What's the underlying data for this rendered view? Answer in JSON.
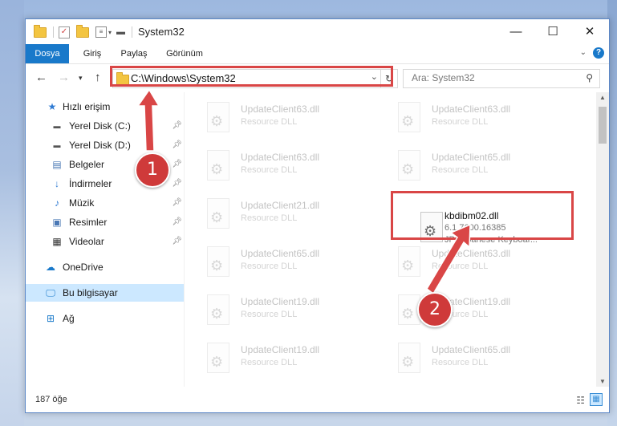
{
  "window": {
    "title": "System32",
    "controls": {
      "minimize": "—",
      "maximize": "☐",
      "close": "✕"
    }
  },
  "ribbon": {
    "tabs": [
      "Dosya",
      "Giriş",
      "Paylaş",
      "Görünüm"
    ],
    "help": "?"
  },
  "navigation": {
    "address": "C:\\Windows\\System32",
    "search_placeholder": "Ara: System32"
  },
  "sidebar": {
    "items": [
      {
        "label": "Hızlı erişim",
        "icon": "star-icon"
      },
      {
        "label": "Yerel Disk (C:)",
        "icon": "drive-icon"
      },
      {
        "label": "Yerel Disk (D:)",
        "icon": "drive-icon"
      },
      {
        "label": "Belgeler",
        "icon": "documents-icon"
      },
      {
        "label": "İndirmeler",
        "icon": "download-icon"
      },
      {
        "label": "Müzik",
        "icon": "music-icon"
      },
      {
        "label": "Resimler",
        "icon": "pictures-icon"
      },
      {
        "label": "Videolar",
        "icon": "videos-icon"
      },
      {
        "label": "OneDrive",
        "icon": "cloud-icon"
      },
      {
        "label": "Bu bilgisayar",
        "icon": "computer-icon"
      },
      {
        "label": "Ağ",
        "icon": "network-icon"
      }
    ]
  },
  "files": {
    "left_column": [
      {
        "name": "UpdateClient63.dll",
        "desc": "Resource DLL"
      },
      {
        "name": "UpdateClient63.dll",
        "desc": "Resource DLL"
      },
      {
        "name": "UpdateClient21.dll",
        "desc": "Resource DLL"
      },
      {
        "name": "UpdateClient65.dll",
        "desc": "Resource DLL"
      },
      {
        "name": "UpdateClient19.dll",
        "desc": "Resource DLL"
      },
      {
        "name": "UpdateClient19.dll",
        "desc": "Resource DLL"
      }
    ],
    "right_column": [
      {
        "name": "UpdateClient63.dll",
        "desc": "Resource DLL"
      },
      {
        "name": "UpdateClient65.dll",
        "desc": "Resource DLL"
      },
      {
        "name": "UpdateClient63.dll",
        "desc": "Resource DLL"
      },
      {
        "name": "UpdateClient19.dll",
        "desc": "Resource DLL"
      },
      {
        "name": "UpdateClient65.dll",
        "desc": "Resource DLL"
      }
    ],
    "highlighted": {
      "name": "kbdibm02.dll",
      "version": "6.1.7600.16385",
      "desc": "JP Japanese Keyboar..."
    }
  },
  "status": {
    "count": "187 öğe"
  },
  "callouts": [
    "1",
    "2"
  ],
  "colors": {
    "accent": "#1979ca",
    "highlight": "#d94646",
    "selection": "#cce8ff"
  }
}
